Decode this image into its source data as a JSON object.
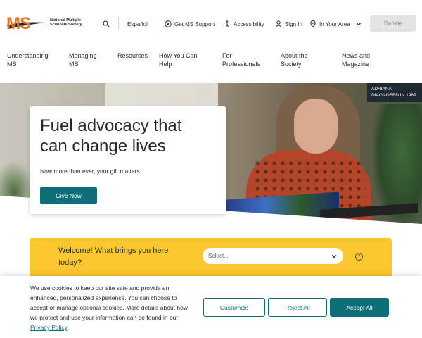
{
  "brand": {
    "logo_mark": "MS",
    "org_name": "National Multiple Sclerosis Society",
    "accent_color": "#e8722a"
  },
  "utility_nav": {
    "search_icon": "search-icon",
    "language": "Español",
    "support": "Get MS Support",
    "accessibility": "Accessibility",
    "sign_in": "Sign In",
    "area": "In Your Area",
    "donate": "Donate"
  },
  "main_nav": [
    "Understanding MS",
    "Managing MS",
    "Resources",
    "How You Can Help",
    "For Professionals",
    "About the Society",
    "News and Magazine"
  ],
  "hero": {
    "title": "Fuel advocacy that can change lives",
    "subtitle": "Now more than ever, your gift matters.",
    "cta": "Give Now",
    "caption_name": "ADRIANA",
    "caption_detail": "DIAGNOSED IN 1989",
    "primary_color": "#0e6e78"
  },
  "welcome": {
    "question": "Welcome! What brings you here today?",
    "select_placeholder": "Select...",
    "help_icon": "question-icon",
    "band_color": "#fdc82f"
  },
  "cookie": {
    "text_before_link": "We use cookies to keep our site safe and provide an enhanced, personalized experience. You can choose to accept or manage optional cookies. More details about how we protect and use your information can be found in our ",
    "link_text": "Privacy Policy",
    "text_after_link": ".",
    "customize": "Customize",
    "reject": "Reject All",
    "accept": "Accept All"
  }
}
